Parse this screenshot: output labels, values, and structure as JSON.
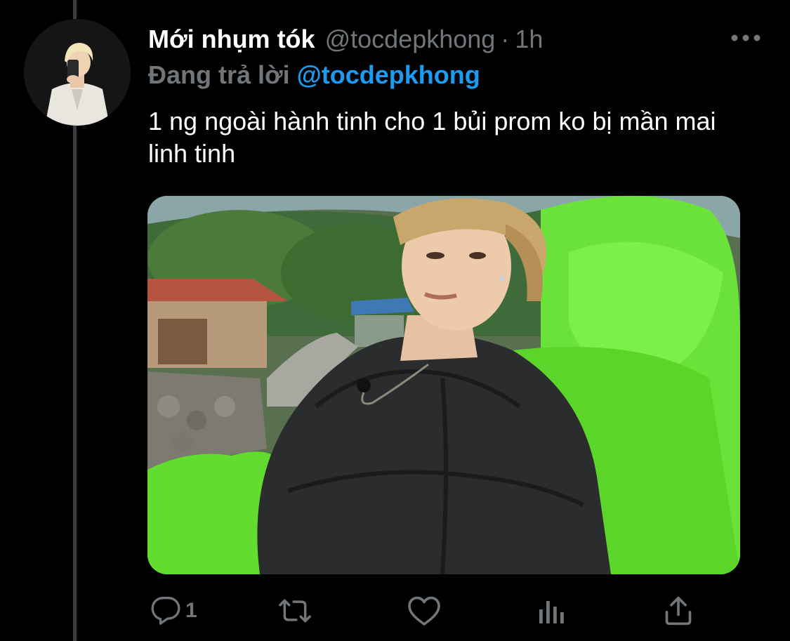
{
  "tweet": {
    "display_name": "Mới nhụm tók",
    "handle": "@tocdepkhong",
    "separator": "·",
    "time": "1h",
    "reply_prefix": "Đang trả lời",
    "reply_handle": "@tocdepkhong",
    "text": "1 ng ngoài hành tinh cho 1 bủi prom ko bị mần mai linh tinh"
  },
  "icons": {
    "more": "more-horizontal-icon",
    "reply": "comment-icon",
    "retweet": "retweet-icon",
    "like": "heart-icon",
    "analytics": "analytics-icon",
    "share": "share-icon"
  },
  "actions": {
    "reply_count": "1"
  },
  "colors": {
    "background": "#000000",
    "text": "#ffffff",
    "muted": "#71767b",
    "link": "#1d9bf0",
    "thread_line": "#3a3d40"
  }
}
